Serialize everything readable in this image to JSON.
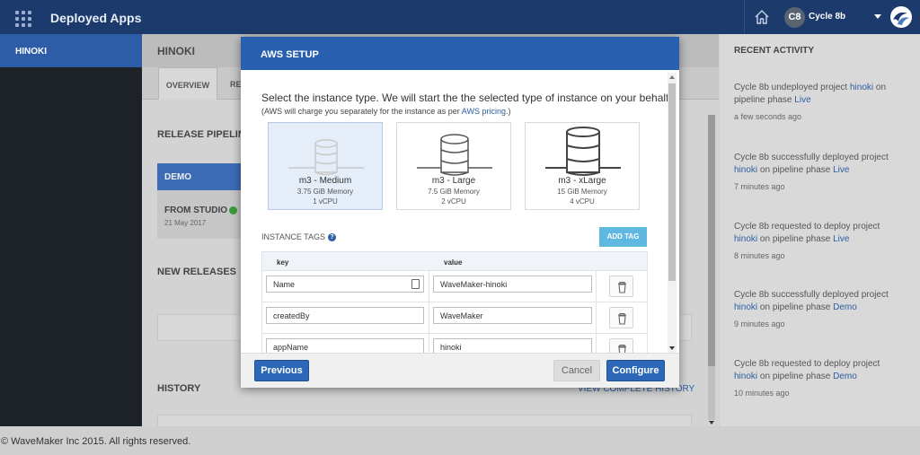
{
  "topbar": {
    "app_title": "Deployed Apps",
    "avatar_initials": "C8",
    "user_name": "Cycle 8b",
    "icons": [
      "apps-grid-icon",
      "home-icon",
      "chevron-down-icon",
      "wavemaker-logo-icon"
    ]
  },
  "sidebar": {
    "selected_project": "HINOKI"
  },
  "main": {
    "project_title": "HINOKI",
    "tabs": [
      {
        "label": "OVERVIEW"
      },
      {
        "label": "RE"
      }
    ],
    "release_pipeline_label": "RELEASE PIPELINE",
    "demo_phase": "DEMO",
    "from_studio": "FROM STUDIO",
    "from_studio_date": "21 May 2017",
    "new_releases_label": "NEW RELEASES",
    "history_label": "HISTORY",
    "view_history_link": "VIEW COMPLETE HISTORY"
  },
  "recent_activity": {
    "title": "RECENT ACTIVITY",
    "items": [
      {
        "pre": "Cycle 8b undeployed project ",
        "project": "hinoki",
        "mid": " on pipeline phase ",
        "phase": "Live",
        "time": "a few seconds ago"
      },
      {
        "pre": "Cycle 8b successfully deployed project ",
        "project": "hinoki",
        "mid": " on pipeline phase ",
        "phase": "Live",
        "time": "7 minutes ago"
      },
      {
        "pre": "Cycle 8b requested to deploy project ",
        "project": "hinoki",
        "mid": " on pipeline phase ",
        "phase": "Live",
        "time": "8 minutes ago"
      },
      {
        "pre": "Cycle 8b successfully deployed project ",
        "project": "hinoki",
        "mid": " on pipeline phase ",
        "phase": "Demo",
        "time": "9 minutes ago"
      },
      {
        "pre": "Cycle 8b requested to deploy project ",
        "project": "hinoki",
        "mid": " on pipeline phase ",
        "phase": "Demo",
        "time": "10 minutes ago"
      }
    ]
  },
  "modal": {
    "title": "AWS SETUP",
    "intro": "Select the instance type. We will start the the selected type of instance on your behalf.",
    "note_pre": "(AWS will charge you separately for the instance as per ",
    "note_link": "AWS pricing",
    "note_post": ".)",
    "instances": [
      {
        "name": "m3 - Medium",
        "memory": "3.75 GiB Memory",
        "cpu": "1 vCPU",
        "selected": true
      },
      {
        "name": "m3 - Large",
        "memory": "7.5 GiB Memory",
        "cpu": "2 vCPU",
        "selected": false
      },
      {
        "name": "m3 - xLarge",
        "memory": "15 GiB Memory",
        "cpu": "4 vCPU",
        "selected": false
      }
    ],
    "tags_label": "INSTANCE TAGS",
    "add_tag_label": "ADD TAG",
    "table_headers": {
      "key": "key",
      "value": "value"
    },
    "tags": [
      {
        "key": "Name",
        "value": "WaveMaker-hinoki"
      },
      {
        "key": "createdBy",
        "value": "WaveMaker"
      },
      {
        "key": "appName",
        "value": "hinoki"
      }
    ],
    "buttons": {
      "previous": "Previous",
      "cancel": "Cancel",
      "configure": "Configure"
    }
  },
  "footer": {
    "copyright": "© WaveMaker Inc 2015. All rights reserved."
  },
  "colors": {
    "topbar": "#1c3a6b",
    "modal_header": "#285faf",
    "primary_button": "#2d68b8",
    "add_tag": "#5fb8e0",
    "link": "#2d5ea0"
  }
}
